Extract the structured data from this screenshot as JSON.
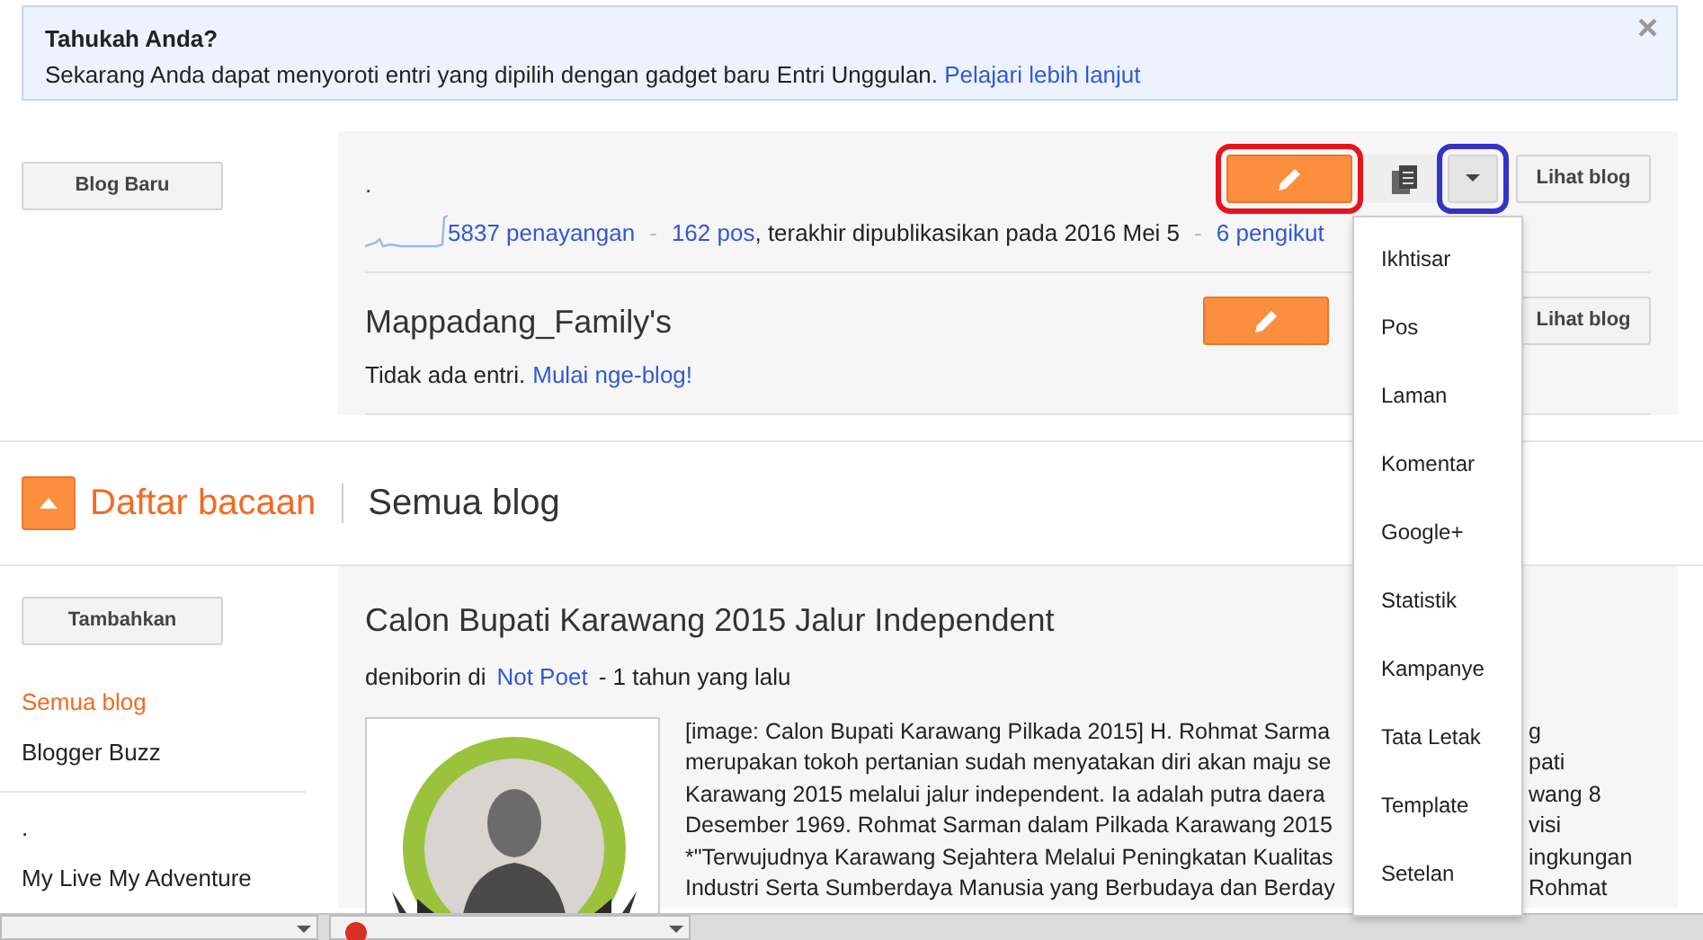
{
  "notice": {
    "title": "Tahukah Anda?",
    "text": "Sekarang Anda dapat menyoroti entri yang dipilih dengan gadget baru Entri Unggulan.",
    "link": "Pelajari lebih lanjut",
    "close": "×"
  },
  "new_blog_button": "Blog Baru",
  "blogs": [
    {
      "kind": "stats",
      "title": ".",
      "view_button": "Lihat blog",
      "edit_highlighted": true,
      "menu_highlighted": true,
      "stats": [
        {
          "kind": "link",
          "text": "5837 penayangan"
        },
        {
          "kind": "sep",
          "text": "-"
        },
        {
          "kind": "link",
          "text": "162 pos"
        },
        {
          "kind": "text",
          "text": ", terakhir dipublikasikan pada 2016 Mei 5"
        },
        {
          "kind": "sep",
          "text": "-"
        },
        {
          "kind": "link",
          "text": "6 pengikut"
        }
      ]
    },
    {
      "kind": "empty",
      "title": "Mappadang_Family's",
      "view_button": "Lihat blog",
      "note": "Tidak ada entri.",
      "note_link": "Mulai nge-blog!"
    }
  ],
  "menu": {
    "expanded": true,
    "items": [
      "Ikhtisar",
      "Pos",
      "Laman",
      "Komentar",
      "Google+",
      "Statistik",
      "Kampanye",
      "Tata Letak",
      "Template",
      "Setelan"
    ]
  },
  "reading_list": {
    "title": "Daftar bacaan",
    "subtitle": "Semua blog",
    "expanded": true
  },
  "add_button": "Tambahkan",
  "sidebar_groups": [
    [
      {
        "label": "Semua blog",
        "selected": true
      },
      {
        "label": "Blogger Buzz",
        "selected": false
      }
    ],
    [
      {
        "label": ".",
        "selected": false
      },
      {
        "label": "My Live My Adventure",
        "selected": false
      }
    ]
  ],
  "post": {
    "title": "Calon Bupati Karawang 2015 Jalur Independent",
    "author": "deniborin di",
    "blog": "Not Poet",
    "age": "- 1 tahun yang lalu",
    "excerpt_lines": [
      {
        "left": "[image: Calon Bupati Karawang Pilkada 2015] H. Rohmat Sarma",
        "right": "g"
      },
      {
        "left": "merupakan tokoh pertanian sudah menyatakan diri akan maju se",
        "right": "pati"
      },
      {
        "left": "Karawang 2015 melalui jalur independent. Ia adalah putra daera",
        "right": "wang 8"
      },
      {
        "left": "Desember 1969. Rohmat Sarman dalam Pilkada Karawang 2015",
        "right": "visi"
      },
      {
        "left": "*\"Terwujudnya Karawang Sejahtera Melalui Peningkatan Kualitas",
        "right": "ingkungan"
      },
      {
        "left": "Industri Serta Sumberdaya Manusia yang Berbudaya dan Berday",
        "right": "Rohmat"
      }
    ]
  },
  "download_bar": [
    {
      "icon": false
    },
    {
      "icon": true
    }
  ]
}
